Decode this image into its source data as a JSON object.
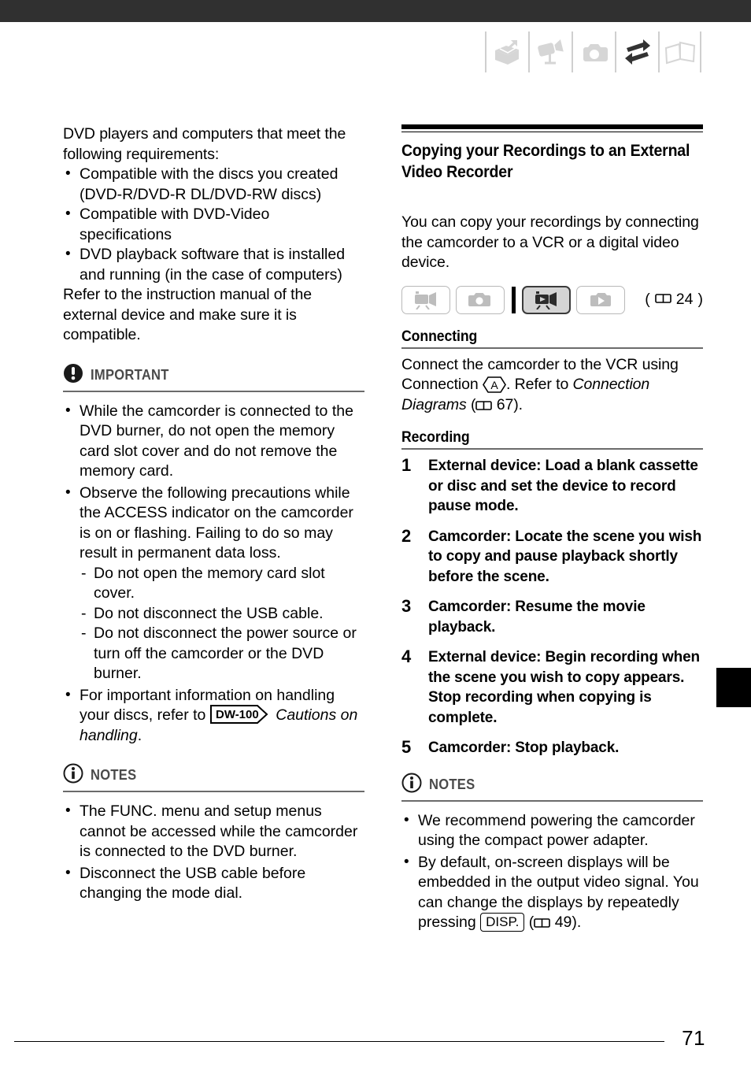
{
  "header": {
    "icons": [
      {
        "name": "unpacking-box-icon",
        "label": "Introduction / Getting Started",
        "state": "inactive"
      },
      {
        "name": "camcorder-icon",
        "label": "Video Recording",
        "state": "inactive"
      },
      {
        "name": "photo-camera-icon",
        "label": "Photo Recording",
        "state": "inactive"
      },
      {
        "name": "two-way-arrows-icon",
        "label": "External Connections",
        "state": "active"
      },
      {
        "name": "open-book-icon",
        "label": "Additional Information",
        "state": "inactive"
      }
    ]
  },
  "left_column": {
    "intro_paragraph": "DVD players and computers that meet the following requirements:",
    "requirement_bullets": [
      "Compatible with the discs you created (DVD-R/DVD-R DL/DVD-RW discs)",
      "Compatible with DVD-Video specifications",
      "DVD playback software that is installed and running (in the case of computers)"
    ],
    "closing_paragraph": "Refer to the instruction manual of the external device and make sure it is compatible.",
    "important": {
      "title": "IMPORTANT",
      "icon": "exclamation-circle-icon",
      "bullets": [
        "While the camcorder is connected to the DVD burner, do not open the memory card slot cover and do not remove the memory card.",
        "Observe the following precautions while the ACCESS indicator on the camcorder is on or flashing. Failing to do so may result in permanent data loss."
      ],
      "sub_dashes": [
        "Do not open the memory card slot cover.",
        "Do not disconnect the USB cable.",
        "Do not disconnect the power source or turn off the camcorder or the DVD burner."
      ],
      "last_bullet_prefix": "For important information on handling your discs, refer to",
      "last_bullet_badge": "DW-100",
      "last_bullet_suffix_italic": "Cautions on handling",
      "last_bullet_end": "."
    },
    "notes": {
      "title": "NOTES",
      "icon": "info-circle-icon",
      "bullets": [
        "The FUNC. menu and setup menus cannot be accessed while the camcorder is connected to the DVD burner.",
        "Disconnect the USB cable before changing the mode dial."
      ]
    }
  },
  "right_column": {
    "section_title": "Copying your Recordings to an External Video Recorder",
    "intro_paragraph": "You can copy your recordings by connecting the camcorder to a VCR or a digital video device.",
    "mode_row": {
      "buttons": [
        {
          "name": "mode-video-record",
          "icon": "camcorder-record-icon",
          "active": false
        },
        {
          "name": "mode-photo-record",
          "icon": "photo-camera-icon",
          "active": false
        },
        {
          "name": "mode-video-playback",
          "icon": "camcorder-playback-icon",
          "active": true
        },
        {
          "name": "mode-photo-playback",
          "icon": "photo-playback-icon",
          "active": false
        }
      ],
      "page_ref": "24"
    },
    "connecting": {
      "heading": "Connecting",
      "text_before_badge": "Connect the camcorder to the VCR using Connection",
      "badge": "A",
      "text_after_badge": ". Refer to",
      "italic_ref": "Connection Diagrams",
      "page_ref": "67",
      "text_end": ")."
    },
    "recording": {
      "heading": "Recording",
      "steps": [
        {
          "num": "1",
          "text": "External device: Load a blank cassette or disc and set the device to record pause mode."
        },
        {
          "num": "2",
          "text": "Camcorder: Locate the scene you wish to copy and pause playback shortly before the scene."
        },
        {
          "num": "3",
          "text": "Camcorder: Resume the movie playback."
        },
        {
          "num": "4",
          "text": "External device: Begin recording when the scene you wish to copy appears. Stop recording when copying is complete."
        },
        {
          "num": "5",
          "text": "Camcorder: Stop playback."
        }
      ]
    },
    "notes": {
      "title": "NOTES",
      "icon": "info-circle-icon",
      "bullet_1": "We recommend powering the camcorder using the compact power adapter.",
      "bullet_2_before": "By default, on-screen displays will be embedded in the output video signal. You can change the displays by repeatedly pressing",
      "bullet_2_badge": "DISP.",
      "bullet_2_page_ref": "49",
      "bullet_2_end": ")."
    }
  },
  "footer": {
    "page_number": "71"
  }
}
